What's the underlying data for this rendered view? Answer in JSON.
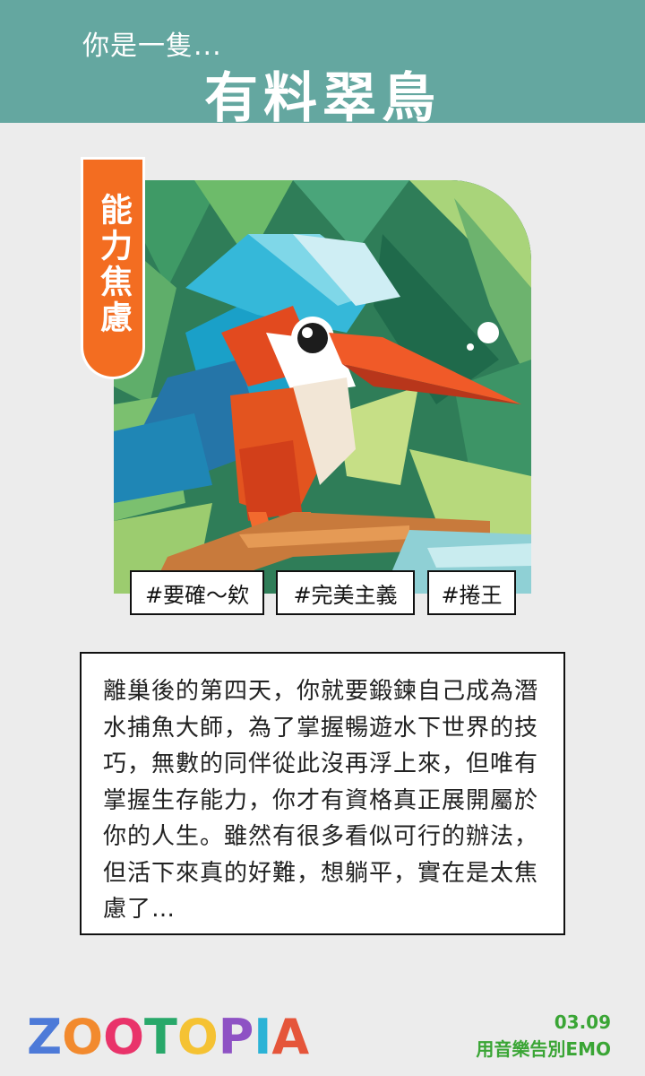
{
  "header": {
    "subtitle": "你是一隻...",
    "title": "有料翠鳥"
  },
  "ribbon": {
    "label": "能力焦慮"
  },
  "tags": [
    "#要確〜欸",
    "#完美主義",
    "#捲王"
  ],
  "description": "離巢後的第四天，你就要鍛鍊自己成為潛水捕魚大師，為了掌握暢遊水下世界的技巧，無數的同伴從此沒再浮上來，但唯有掌握生存能力，你才有資格真正展開屬於你的人生。雖然有很多看似可行的辦法，但活下來真的好難，想躺平，實在是太焦慮了…",
  "footer": {
    "logo": "ZOOTOPIA",
    "date": "03.09",
    "slogan": "用音樂告別EMO"
  },
  "colors": {
    "header_bg": "#64a7a0",
    "ribbon_bg": "#f36d21",
    "footer_text": "#3aa535",
    "page_bg": "#ececec"
  }
}
